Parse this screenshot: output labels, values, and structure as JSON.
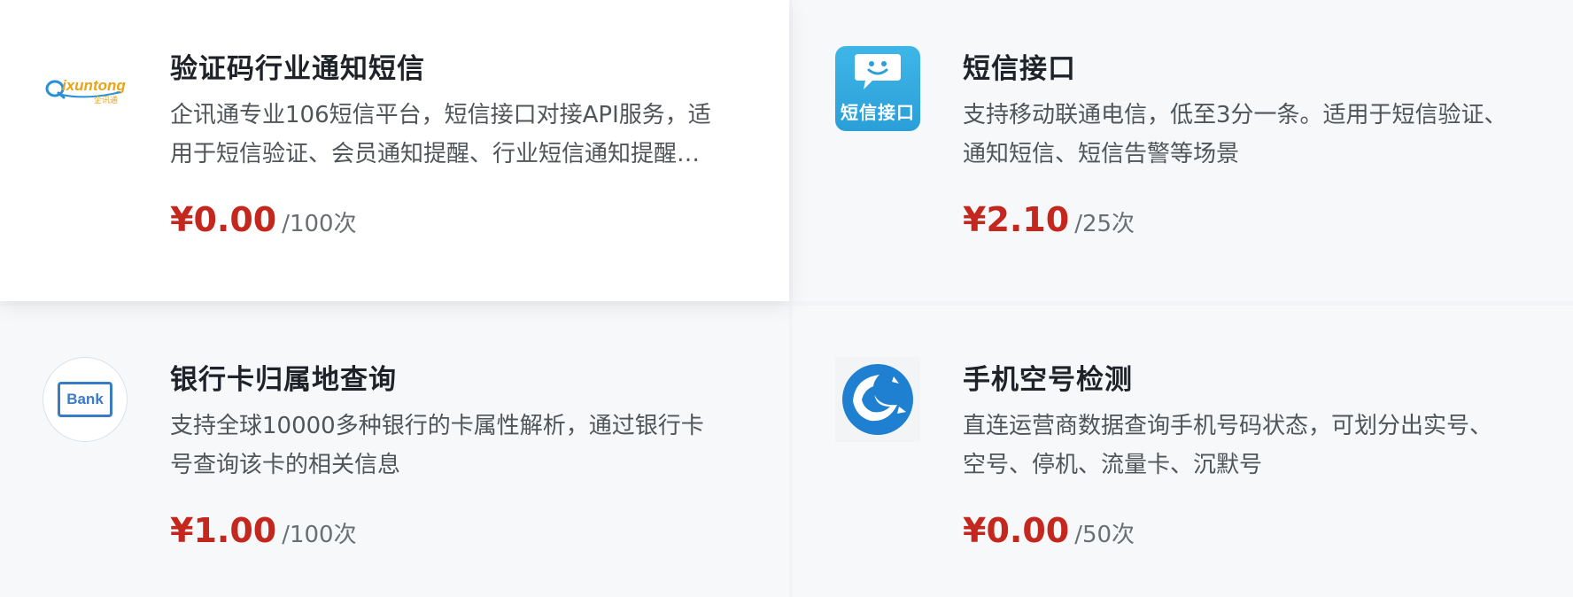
{
  "products": [
    {
      "title": "验证码行业通知短信",
      "description": "企讯通专业106短信平台，短信接口对接API服务，适用于短信验证、会员通知提醒、行业短信通知提醒、营销短信推广",
      "price": "¥0.00",
      "unit": "/100次",
      "logo": {
        "icon": "qixuntong-logo",
        "text_latin": "Qixuntong",
        "text_cn": "企讯通"
      }
    },
    {
      "title": "短信接口",
      "description": "支持移动联通电信，低至3分一条。适用于短信验证、通知短信、短信告警等场景",
      "price": "¥2.10",
      "unit": "/25次",
      "logo": {
        "icon": "sms-chat-logo",
        "text": "短信接口"
      }
    },
    {
      "title": "银行卡归属地查询",
      "description": "支持全球10000多种银行的卡属性解析，通过银行卡号查询该卡的相关信息",
      "price": "¥1.00",
      "unit": "/100次",
      "logo": {
        "icon": "bank-logo",
        "text": "Bank"
      }
    },
    {
      "title": "手机空号检测",
      "description": "直连运营商数据查询手机号码状态，可划分出实号、空号、停机、流量卡、沉默号",
      "price": "¥0.00",
      "unit": "/50次",
      "logo": {
        "icon": "phone-check-logo"
      }
    }
  ],
  "colors": {
    "price": "#c3271d",
    "title": "#1f2329",
    "description": "#505559",
    "sms_blue": "#2a9fd8",
    "bank_blue": "#3a7bc8",
    "globe_blue": "#1f7fd0"
  }
}
